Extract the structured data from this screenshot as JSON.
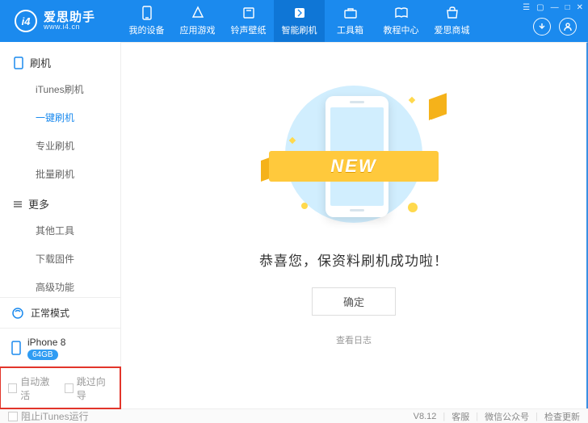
{
  "app": {
    "name": "爱思助手",
    "site": "www.i4.cn",
    "logo_letters": "i4"
  },
  "nav": [
    "我的设备",
    "应用游戏",
    "铃声壁纸",
    "智能刷机",
    "工具箱",
    "教程中心",
    "爱思商城"
  ],
  "nav_active": 3,
  "sidebar": {
    "sec_flash": "刷机",
    "flash_items": [
      "iTunes刷机",
      "一键刷机",
      "专业刷机",
      "批量刷机"
    ],
    "flash_active": 1,
    "sec_more": "更多",
    "more_items": [
      "其他工具",
      "下载固件",
      "高级功能"
    ]
  },
  "mode": {
    "label": "正常模式"
  },
  "device": {
    "name": "iPhone 8",
    "storage": "64GB"
  },
  "options": {
    "auto_activate": "自动激活",
    "skip_wizard": "跳过向导"
  },
  "main": {
    "ribbon": "NEW",
    "message": "恭喜您，保资料刷机成功啦！",
    "ok": "确定",
    "log": "查看日志"
  },
  "footer": {
    "block_itunes": "阻止iTunes运行",
    "version": "V8.12",
    "support": "客服",
    "wechat": "微信公众号",
    "update": "检查更新"
  }
}
